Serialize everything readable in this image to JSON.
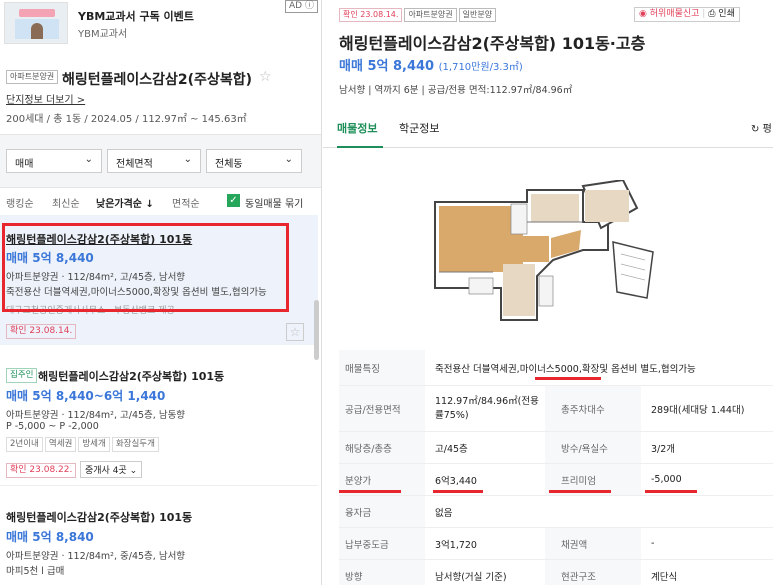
{
  "ad": {
    "title": "YBM교과서 구독 이벤트",
    "subtitle": "YBM교과서",
    "badge": "AD ⓘ"
  },
  "complex": {
    "tag": "아파트분양권",
    "name": "해링턴플레이스감삼2(주상복합)",
    "info_link": "단지정보 더보기 >",
    "summary": "200세대 / 총 1동 / 2024.05 / 112.97㎡ ~ 145.63㎡"
  },
  "filters": {
    "deal_type": "매매",
    "area": "전체면적",
    "building": "전체동"
  },
  "sort": {
    "options": [
      "랭킹순",
      "최신순",
      "낮은가격순 ↓",
      "면적순"
    ],
    "active_index": 2,
    "same_listing_label": "동일매물 묶기"
  },
  "listings": [
    {
      "title": "해링턴플레이스감삼2(주상복합) 101동",
      "price": "매매 5억 8,440",
      "detail": "아파트분양권 · 112/84m², 고/45층, 남서향",
      "desc": "죽전용산 더블역세권,마이너스5000,확장및 옵션비 별도,협의가능",
      "agent": "대구교천공인중개사사무소 · 부동산뱅크 제공",
      "confirm": "확인 23.08.14."
    },
    {
      "badge": "집주인",
      "title": "해링턴플레이스감삼2(주상복합) 101동",
      "price": "매매 5억 8,440~6억 1,440",
      "detail": "아파트분양권 · 112/84m², 고/45층, 남동향",
      "premium": "P -5,000 ~ P -2,000",
      "tags": [
        "2년이내",
        "역세권",
        "방세개",
        "화장실두개"
      ],
      "confirm": "확인 23.08.22.",
      "agents": "중개사 4곳"
    },
    {
      "title": "해링턴플레이스감삼2(주상복합) 101동",
      "price": "매매 5억 8,840",
      "detail": "아파트분양권 · 112/84m², 중/45층, 남서향",
      "desc": "마피5천 l 급매"
    }
  ],
  "detail": {
    "tags": [
      "확인 23.08.14.",
      "아파트분양권",
      "일반분양"
    ],
    "report_label": "허위매물신고",
    "print_label": "인쇄",
    "name": "해링턴플레이스감삼2(주상복합) 101동·고층",
    "price": "매매 5억 8,440",
    "price_per": "(1,710만원/3.3㎡)",
    "meta": "남서향 | 역까지 6분 | 공급/전용 면적:112.97㎡/84.96㎡",
    "tabs": [
      "매물정보",
      "학군정보"
    ],
    "refresh": "평",
    "rows": [
      {
        "label": "매물특징",
        "value": "죽전용산 더블역세권,마이너스5000,확장및 옵션비 별도,협의가능"
      },
      {
        "label": "공급/전용면적",
        "value": "112.97㎡/84.96㎡(전용률75%)",
        "label2": "총주차대수",
        "value2": "289대(세대당 1.44대)"
      },
      {
        "label": "해당층/총층",
        "value": "고/45층",
        "label2": "방수/욕실수",
        "value2": "3/2개"
      },
      {
        "label": "분양가",
        "value": "6억3,440",
        "label2": "프리미엄",
        "value2": "-5,000"
      },
      {
        "label": "융자금",
        "value": "없음"
      },
      {
        "label": "납부중도금",
        "value": "3억1,720",
        "label2": "채권액",
        "value2": "-"
      },
      {
        "label": "방향",
        "value": "남서향(거실 기준)",
        "label2": "현관구조",
        "value2": "계단식"
      }
    ]
  },
  "colors": {
    "price_blue": "#3b77d8",
    "accent_green": "#1e8f5a",
    "highlight_red": "#e8262d"
  }
}
